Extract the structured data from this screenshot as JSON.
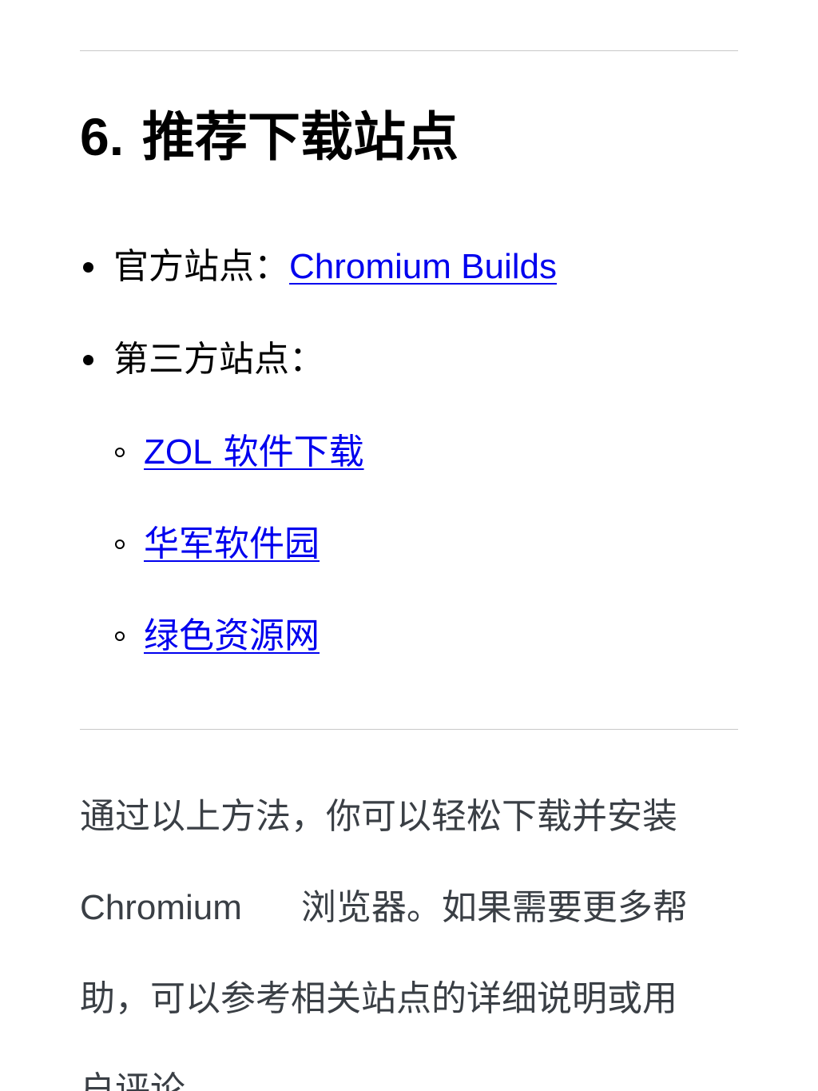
{
  "section": {
    "number": "6.",
    "title": "推荐下载站点"
  },
  "list": {
    "official": {
      "label": "官方站点：",
      "link": "Chromium Builds"
    },
    "third_party": {
      "label": "第三方站点：",
      "links": [
        {
          "prefix": "ZOL",
          "text": " 软件下载"
        },
        {
          "text": "华军软件园"
        },
        {
          "text": "绿色资源网"
        }
      ]
    }
  },
  "conclusion": {
    "line1": "通过以上方法，你可以轻松下载并安装",
    "chromium": "Chromium",
    "line2_rest": "浏览器。如果需要更多帮",
    "line3": "助，可以参考相关站点的详细说明或用",
    "line4": "户评论。"
  }
}
